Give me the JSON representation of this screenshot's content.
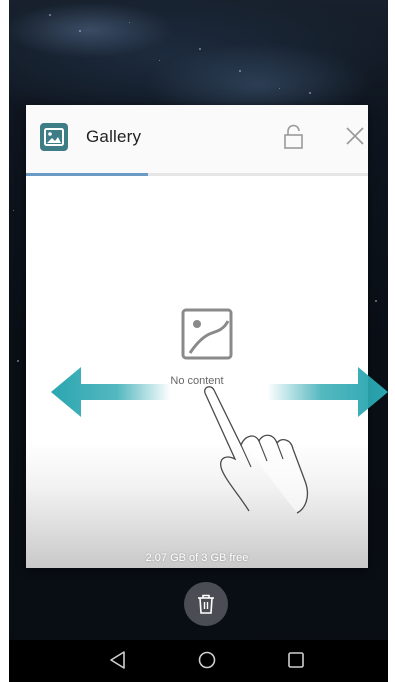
{
  "card": {
    "title": "Gallery",
    "empty_label": "No content",
    "storage_text": "2.07 GB of 3 GB free"
  },
  "icons": {
    "app": "gallery-app-icon",
    "lock": "unlock-icon",
    "close": "close-icon",
    "empty": "image-placeholder-icon",
    "trash": "trash-icon",
    "nav_back": "back-triangle-icon",
    "nav_home": "home-circle-icon",
    "nav_recent": "recent-square-icon"
  },
  "colors": {
    "accent": "#6b9ac4",
    "arrow": "#2aa6b0",
    "app_icon": "#3f7d86"
  }
}
